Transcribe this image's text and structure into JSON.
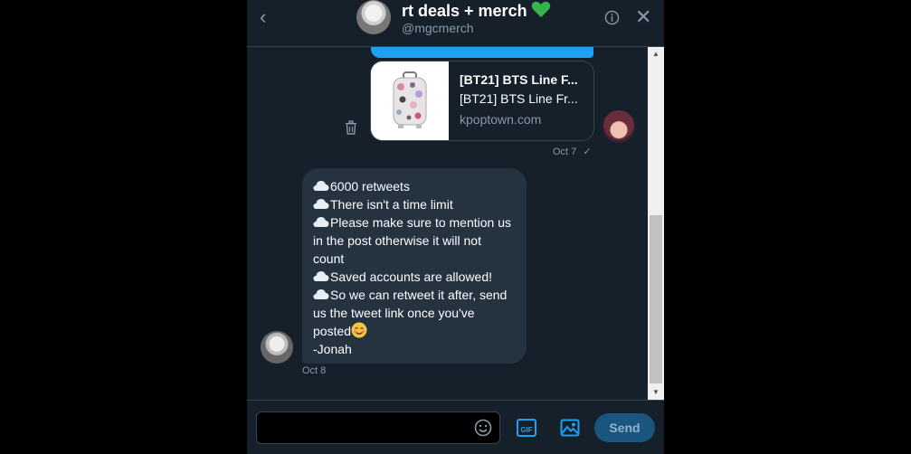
{
  "header": {
    "title": "rt deals + merch",
    "handle": "@mgcmerch"
  },
  "link_card": {
    "title": "[BT21] BTS Line F...",
    "description": "[BT21] BTS Line Fr...",
    "domain": "kpoptown.com"
  },
  "outgoing": {
    "timestamp": "Oct 7",
    "status_mark": "✓"
  },
  "incoming": {
    "lines": [
      "6000 retweets",
      "There isn't a time limit",
      "Please make sure to mention us",
      "in the post otherwise it will not",
      "count",
      "Saved accounts are allowed!",
      "So we can retweet it after, send",
      "us the tweet link once you've",
      "posted",
      "-Jonah"
    ],
    "timestamp": "Oct 8"
  },
  "composer": {
    "placeholder": "",
    "send_label": "Send",
    "gif_label": "GIF"
  },
  "icons": {
    "back": "chevron-left-icon",
    "info": "info-icon",
    "close": "close-icon",
    "heart": "green-heart-icon",
    "trash": "trash-icon",
    "cloud": "cloud-icon",
    "emoji": "emoji-icon",
    "gif": "gif-icon",
    "media": "image-icon"
  },
  "colors": {
    "background": "#15202b",
    "accent": "#1da1f2",
    "border": "#38444d",
    "muted_text": "#8899a6",
    "bubble": "#253341",
    "send_button": "#1a5580",
    "heart": "#35b44a"
  }
}
